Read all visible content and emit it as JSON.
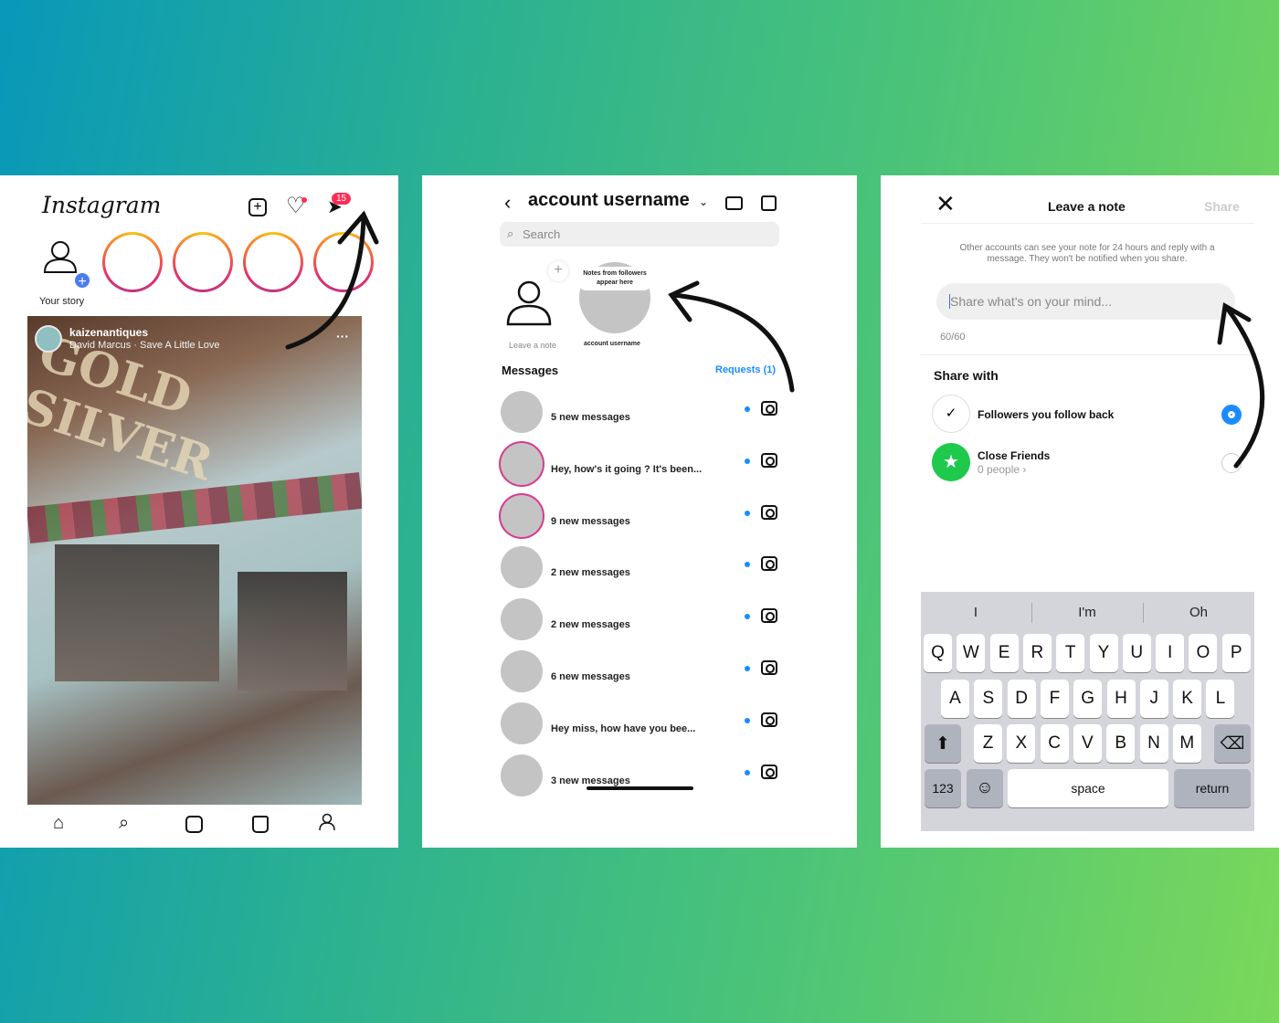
{
  "panel1": {
    "logo": "Instagram",
    "badge": "15",
    "your_story": "Your story",
    "post": {
      "username": "kaizenantiques",
      "audio": "David Marcus · Save A Little Love",
      "more": "···",
      "sign_text": "GOLD SILVER"
    },
    "nav": [
      "home-icon",
      "search-icon",
      "reels-icon",
      "shop-icon",
      "profile-icon"
    ]
  },
  "panel2": {
    "title": "account username",
    "search_placeholder": "Search",
    "leave_note": "Leave a note",
    "note_bubble": "Notes from followers appear here",
    "note_user": "account username",
    "messages_label": "Messages",
    "requests": "Requests (1)",
    "threads": [
      {
        "text": "5 new messages",
        "story": false
      },
      {
        "text": "Hey, how's it going ? It's been...",
        "story": true
      },
      {
        "text": "9 new messages",
        "story": true
      },
      {
        "text": "2 new messages",
        "story": false
      },
      {
        "text": "2 new messages",
        "story": false
      },
      {
        "text": "6 new messages",
        "story": false
      },
      {
        "text": "Hey miss, how have you bee...",
        "story": false
      },
      {
        "text": "3 new messages",
        "story": false
      }
    ]
  },
  "panel3": {
    "title": "Leave a note",
    "share": "Share",
    "info": "Other accounts can see your note for 24 hours and reply with a message. They won't be notified when you share.",
    "input_placeholder": "Share what's on your mind...",
    "counter": "60/60",
    "share_with": "Share with",
    "options": [
      {
        "label": "Followers you follow back",
        "selected": true
      },
      {
        "label": "Close Friends",
        "sub": "0 people",
        "selected": false
      }
    ],
    "keyboard": {
      "suggestions": [
        "I",
        "I'm",
        "Oh"
      ],
      "row1": [
        "Q",
        "W",
        "E",
        "R",
        "T",
        "Y",
        "U",
        "I",
        "O",
        "P"
      ],
      "row2": [
        "A",
        "S",
        "D",
        "F",
        "G",
        "H",
        "J",
        "K",
        "L"
      ],
      "row3": [
        "Z",
        "X",
        "C",
        "V",
        "B",
        "N",
        "M"
      ],
      "numbers": "123",
      "space": "space",
      "return": "return"
    }
  },
  "colors": {
    "accent": "#1a8cff",
    "badge": "#ff2d55",
    "close_friends": "#1ec94c"
  }
}
